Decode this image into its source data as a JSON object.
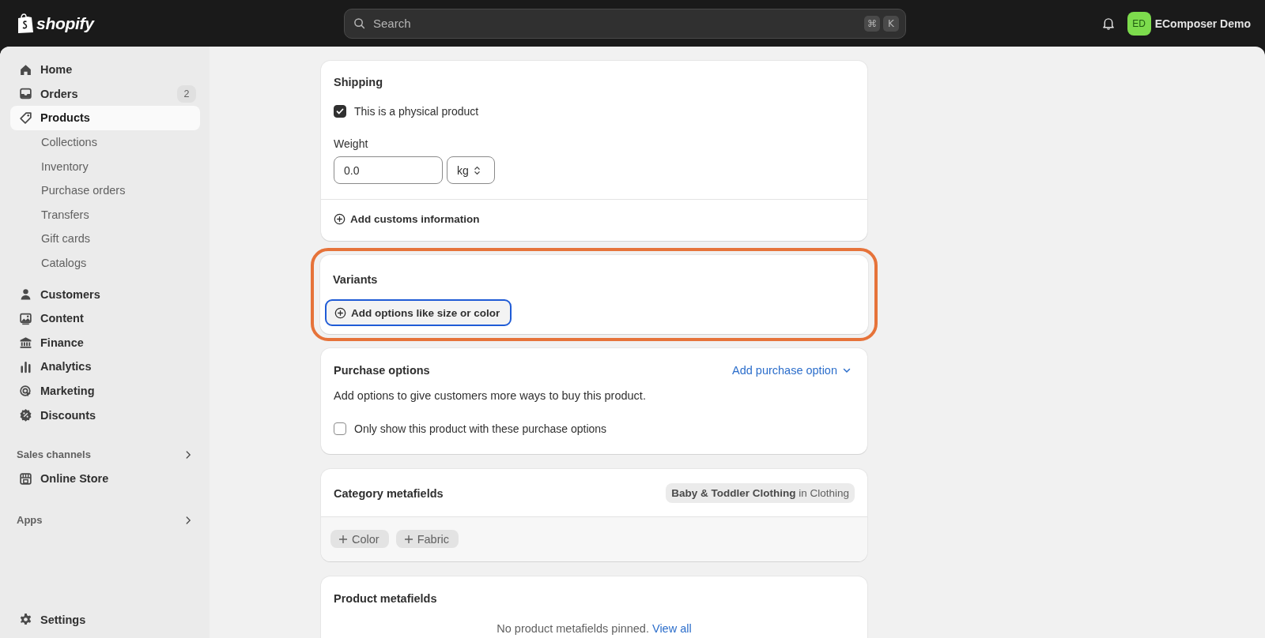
{
  "topbar": {
    "logo": "shopify",
    "search_placeholder": "Search",
    "shortcut_keys": [
      "⌘",
      "K"
    ],
    "avatar_initials": "ED",
    "store_name": "EComposer Demo"
  },
  "sidebar": {
    "items": [
      {
        "label": "Home",
        "selected": false
      },
      {
        "label": "Orders",
        "badge": "2",
        "selected": false
      },
      {
        "label": "Products",
        "selected": true,
        "children": [
          {
            "label": "Collections",
            "selected": false
          },
          {
            "label": "Inventory",
            "selected": false
          },
          {
            "label": "Purchase orders",
            "selected": false
          },
          {
            "label": "Transfers",
            "selected": false
          },
          {
            "label": "Gift cards",
            "selected": false
          },
          {
            "label": "Catalogs",
            "selected": false
          }
        ]
      },
      {
        "label": "Customers",
        "selected": false
      },
      {
        "label": "Content",
        "selected": false
      },
      {
        "label": "Finance",
        "selected": false
      },
      {
        "label": "Analytics",
        "selected": false
      },
      {
        "label": "Marketing",
        "selected": false
      },
      {
        "label": "Discounts",
        "selected": false
      }
    ],
    "sections": [
      {
        "title": "Sales channels",
        "items": [
          {
            "label": "Online Store",
            "selected": false
          }
        ]
      },
      {
        "title": "Apps"
      }
    ],
    "settings": {
      "label": "Settings",
      "selected": false
    }
  },
  "shipping": {
    "title": "Shipping",
    "physical": {
      "label": "This is a physical product",
      "checked": true
    },
    "weight_label": "Weight",
    "weight_value": "0.0",
    "unit": "kg",
    "customs_link": "Add customs information"
  },
  "variants": {
    "title": "Variants",
    "highlighted": true,
    "add_button": {
      "label": "Add options like size or color",
      "focused": true
    }
  },
  "purchase_options": {
    "title": "Purchase options",
    "action": "Add purchase option",
    "description": "Add options to give customers more ways to buy this product.",
    "only_show": {
      "label": "Only show this product with these purchase options",
      "checked": false
    }
  },
  "category_metafields": {
    "title": "Category metafields",
    "category": "Baby & Toddler Clothing",
    "parent": "in Clothing",
    "chips": [
      "Color",
      "Fabric"
    ]
  },
  "product_metafields": {
    "title": "Product metafields",
    "empty_text": "No product metafields pinned.",
    "link": "View all"
  }
}
